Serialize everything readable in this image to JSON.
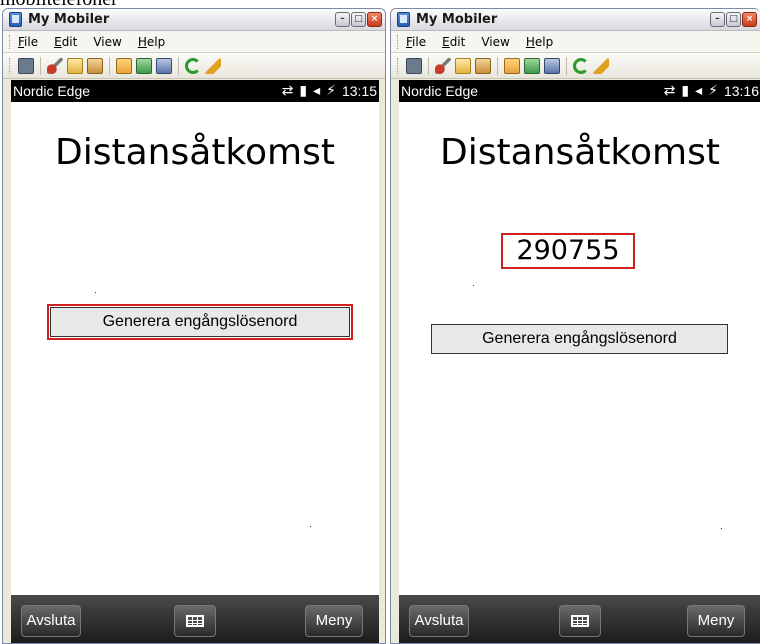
{
  "caption": "mobiltelefoner",
  "windows": [
    {
      "title": "My Mobiler",
      "menu": [
        {
          "label": "File"
        },
        {
          "label": "Edit"
        },
        {
          "label": "View"
        },
        {
          "label": "Help"
        }
      ],
      "status": {
        "carrier": "Nordic Edge",
        "time": "13:15"
      },
      "app_title": "Distansåtkomst",
      "otp": "",
      "button_label": "Generera engångslösenord",
      "softkeys": {
        "left": "Avsluta",
        "right": "Meny"
      }
    },
    {
      "title": "My Mobiler",
      "menu": [
        {
          "label": "File"
        },
        {
          "label": "Edit"
        },
        {
          "label": "View"
        },
        {
          "label": "Help"
        }
      ],
      "status": {
        "carrier": "Nordic Edge",
        "time": "13:16"
      },
      "app_title": "Distansåtkomst",
      "otp": "290755",
      "button_label": "Generera engångslösenord",
      "softkeys": {
        "left": "Avsluta",
        "right": "Meny"
      }
    }
  ],
  "icons": {
    "window_buttons": [
      "minimize-icon",
      "maximize-icon",
      "close-icon"
    ],
    "toolbar": [
      "monitor-icon",
      "cut-icon",
      "copy-icon",
      "paste-icon",
      "screen1-icon",
      "screen2-icon",
      "screen3-icon",
      "refresh-icon",
      "clean-icon"
    ],
    "status": [
      "sync-icon",
      "signal-icon",
      "volume-icon",
      "plug-icon"
    ],
    "softbar": [
      "keyboard-icon"
    ]
  },
  "colors": {
    "highlight": "#d02020",
    "statusbar": "#000000"
  }
}
